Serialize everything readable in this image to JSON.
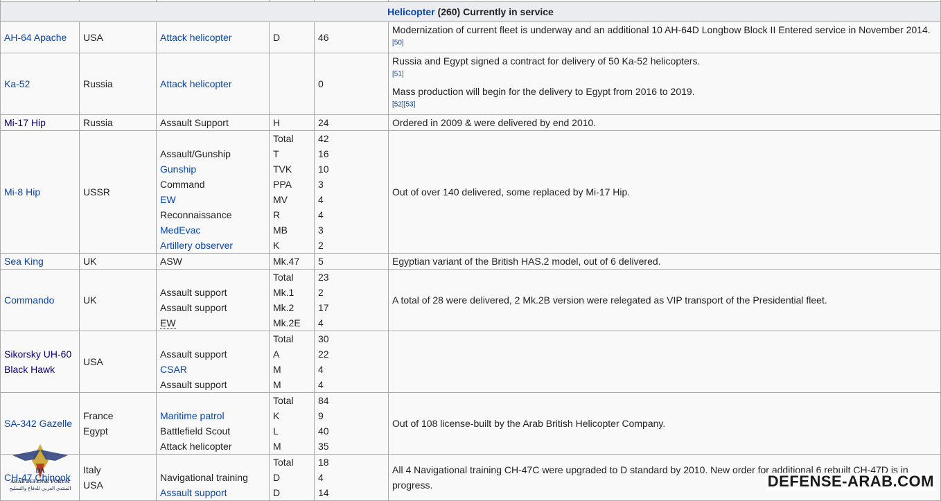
{
  "section": {
    "link": "Helicopter",
    "rest": " (260) Currently in service"
  },
  "rows": [
    {
      "name": "AH-64 Apache",
      "origin": [
        "USA"
      ],
      "roles": [
        {
          "text": "Attack helicopter",
          "link": true
        }
      ],
      "versions": [
        "D"
      ],
      "counts": [
        "46"
      ],
      "notes": "Modernization of current fleet is underway and an additional 10 AH-64D Longbow Block II Entered service in November 2014.",
      "refs": [
        "[50]"
      ]
    },
    {
      "name": "Ka-52",
      "origin": [
        "Russia"
      ],
      "roles": [
        {
          "text": "Attack helicopter",
          "link": true
        }
      ],
      "versions": [
        ""
      ],
      "counts": [
        "0"
      ],
      "notes_parts": [
        {
          "text": "Russia and Egypt signed a contract for delivery of 50 Ka-52 helicopters."
        },
        {
          "ref": "[51]"
        },
        {
          "text": " Mass production will begin for the delivery to Egypt from 2016 to 2019. "
        },
        {
          "ref": "[52][53]"
        }
      ]
    },
    {
      "name": "Mi-17 Hip",
      "origin": [
        "Russia"
      ],
      "roles": [
        {
          "text": "Assault Support",
          "link": false
        }
      ],
      "versions": [
        "H"
      ],
      "counts": [
        "24"
      ],
      "notes": "Ordered in 2009 & were delivered by end 2010."
    },
    {
      "name": "Mi-8 Hip",
      "origin": [
        "USSR"
      ],
      "roles": [
        {
          "text": "",
          "link": false
        },
        {
          "text": "Assault/Gunship",
          "link": false
        },
        {
          "text": "Gunship",
          "link": true
        },
        {
          "text": "Command",
          "link": false
        },
        {
          "text": "EW",
          "link": true
        },
        {
          "text": "Reconnaissance",
          "link": false
        },
        {
          "text": "MedEvac",
          "link": true
        },
        {
          "text": "Artillery observer",
          "link": true
        }
      ],
      "versions": [
        "Total",
        "T",
        "TVK",
        "PPA",
        "MV",
        "R",
        "MB",
        "K"
      ],
      "counts": [
        "42",
        "16",
        "10",
        "3",
        "4",
        "4",
        "3",
        "2"
      ],
      "notes": "Out of over 140 delivered, some replaced by Mi-17 Hip."
    },
    {
      "name": "Sea King",
      "origin": [
        "UK"
      ],
      "roles": [
        {
          "text": "ASW",
          "link": false
        }
      ],
      "versions": [
        "Mk.47"
      ],
      "counts": [
        "5"
      ],
      "notes": "Egyptian variant of the British HAS.2 model, out of 6 delivered."
    },
    {
      "name": "Commando",
      "origin": [
        "UK"
      ],
      "roles": [
        {
          "text": "",
          "link": false
        },
        {
          "text": "Assault support",
          "link": false
        },
        {
          "text": "Assault support",
          "link": false
        },
        {
          "text": "EW",
          "link": false,
          "abbr": true
        }
      ],
      "versions": [
        "Total",
        "Mk.1",
        "Mk.2",
        "Mk.2E"
      ],
      "counts": [
        "23",
        "2",
        "17",
        "4"
      ],
      "notes": "A total of 28 were delivered, 2 Mk.2B version were relegated as VIP transport of the Presidential fleet."
    },
    {
      "name": "Sikorsky UH-60 Black Hawk",
      "origin": [
        "USA"
      ],
      "roles": [
        {
          "text": "",
          "link": false
        },
        {
          "text": "Assault support",
          "link": false
        },
        {
          "text": "CSAR",
          "link": true
        },
        {
          "text": "Assault support",
          "link": false
        }
      ],
      "versions": [
        "Total",
        "A",
        "M",
        "M"
      ],
      "counts": [
        "30",
        "22",
        "4",
        "4"
      ],
      "notes": ""
    },
    {
      "name": "SA-342 Gazelle",
      "origin": [
        "France",
        "Egypt"
      ],
      "roles": [
        {
          "text": "",
          "link": false
        },
        {
          "text": "Maritime patrol",
          "link": true
        },
        {
          "text": "Battlefield Scout",
          "link": false
        },
        {
          "text": "Attack helicopter",
          "link": false
        }
      ],
      "versions": [
        "Total",
        "K",
        "L",
        "M"
      ],
      "counts": [
        "84",
        "9",
        "40",
        "35"
      ],
      "notes": "Out of 108 license-built by the Arab British Helicopter Company."
    },
    {
      "name": "CH-47 Chinook",
      "origin": [
        "Italy",
        "USA"
      ],
      "roles": [
        {
          "text": "",
          "link": false
        },
        {
          "text": "Navigational training",
          "link": false
        },
        {
          "text": "Assault support",
          "link": true
        }
      ],
      "versions": [
        "Total",
        "D",
        "D"
      ],
      "counts": [
        "18",
        "4",
        "14"
      ],
      "notes": "All 4 Navigational training CH-47C were upgraded to D standard by 2010. New order for additional 6 rebuilt CH-47D is in progress."
    }
  ],
  "logo": {
    "letters": "DA",
    "name": "ARAB DEFENSE FORUM",
    "arabic": "المنتدى العربي للدفاع والتسليح"
  },
  "watermark": "DEFENSE-ARAB.COM"
}
